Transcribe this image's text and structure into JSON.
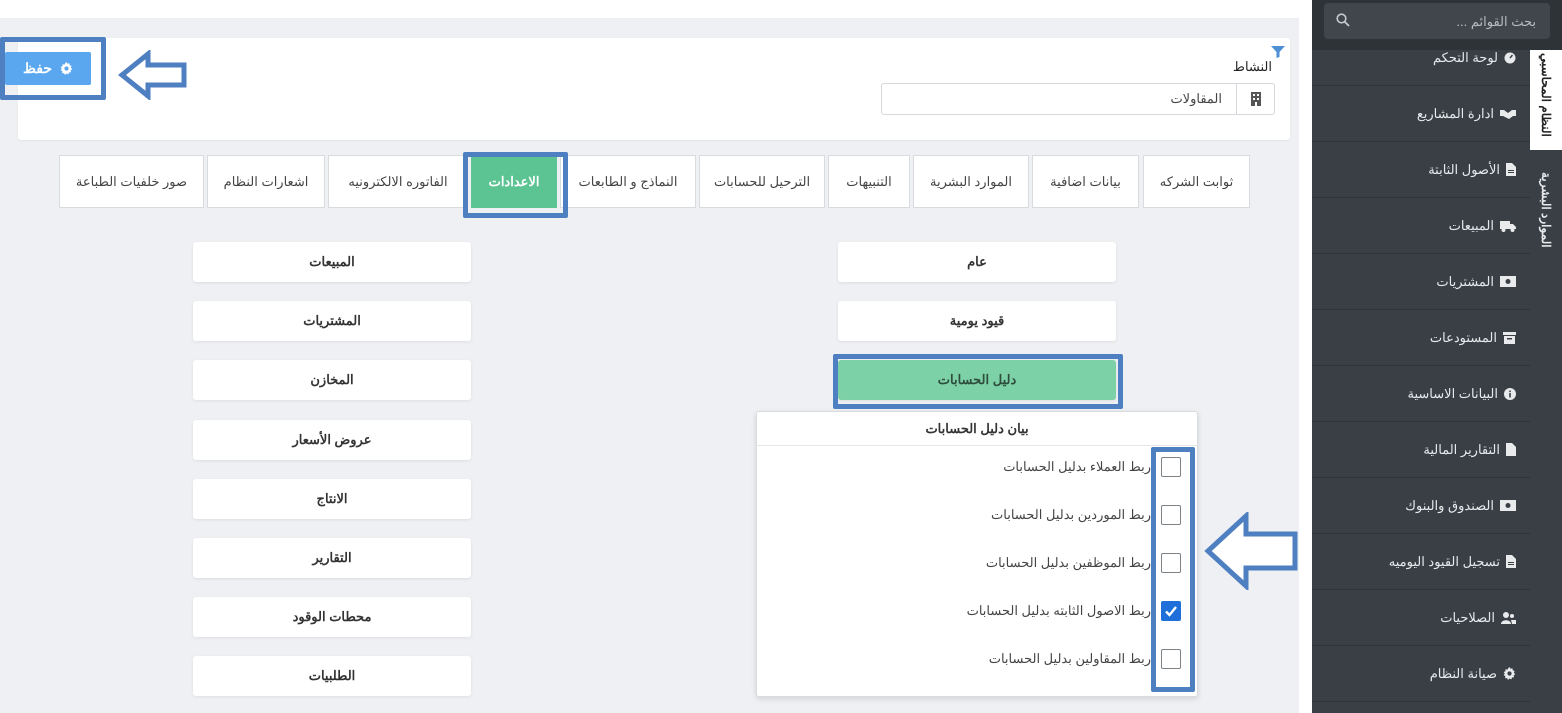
{
  "top": {
    "save_label": "حفظ",
    "activity_label": "النشاط",
    "activity_value": "المقاولات"
  },
  "tabs": [
    {
      "label": "ثوابت الشركه"
    },
    {
      "label": "بيانات اضافية"
    },
    {
      "label": "الموارد البشرية"
    },
    {
      "label": "التنبيهات"
    },
    {
      "label": "الترحيل للحسابات"
    },
    {
      "label": "النماذج و الطابعات"
    },
    {
      "label": "الاعدادات",
      "active": true
    },
    {
      "label": "الفاتوره الالكترونيه"
    },
    {
      "label": "اشعارات النظام"
    },
    {
      "label": "صور خلفيات الطباعة"
    }
  ],
  "right_buttons": [
    {
      "label": "عام"
    },
    {
      "label": "قيود يومية"
    },
    {
      "label": "دليل الحسابات",
      "active": true
    }
  ],
  "left_buttons": [
    {
      "label": "المبيعات"
    },
    {
      "label": "المشتريات"
    },
    {
      "label": "المخازن"
    },
    {
      "label": "عروض الأسعار"
    },
    {
      "label": "الانتاج"
    },
    {
      "label": "التقارير"
    },
    {
      "label": "محطات الوقود"
    },
    {
      "label": "الطلبيات"
    }
  ],
  "coa_panel": {
    "title": "بيان دليل الحسابات",
    "options": [
      {
        "label": "ربط العملاء بدليل الحسابات",
        "checked": false
      },
      {
        "label": "ربط الموردين بدليل الحسابات",
        "checked": false
      },
      {
        "label": "ربط الموظفين بدليل الحسابات",
        "checked": false
      },
      {
        "label": "ربط الاصول الثابته بدليل الحسابات",
        "checked": true
      },
      {
        "label": "ربط المقاولين بدليل الحسابات",
        "checked": false
      }
    ]
  },
  "sidebar": {
    "search_placeholder": "بحث القوائم ...",
    "items": [
      {
        "label": "لوحة التحكم",
        "icon": "dashboard-icon"
      },
      {
        "label": "ادارة المشاريع",
        "icon": "handshake-icon"
      },
      {
        "label": "الأصول الثابتة",
        "icon": "file-icon"
      },
      {
        "label": "المبيعات",
        "icon": "truck-icon"
      },
      {
        "label": "المشتريات",
        "icon": "money-icon"
      },
      {
        "label": "المستودعات",
        "icon": "archive-icon"
      },
      {
        "label": "البيانات الاساسية",
        "icon": "info-icon"
      },
      {
        "label": "التقارير المالية",
        "icon": "file-icon"
      },
      {
        "label": "الصندوق والبنوك",
        "icon": "money-icon"
      },
      {
        "label": "تسجيل القيود اليوميه",
        "icon": "file-icon"
      },
      {
        "label": "الصلاحيات",
        "icon": "users-icon"
      },
      {
        "label": "صيانة النظام",
        "icon": "gear-icon"
      }
    ],
    "vertical_tabs": [
      {
        "label": "النظام المحاسبي",
        "active": true
      },
      {
        "label": "الموارد البشرية",
        "active": false
      }
    ]
  },
  "colors": {
    "active_tab": "#5cc492",
    "active_setting": "#7dd1a6",
    "save_button": "#5aa7f0",
    "highlight": "#4e7fc1",
    "sidebar_bg": "#3a3f45",
    "checkbox_checked": "#1e6fd9"
  }
}
